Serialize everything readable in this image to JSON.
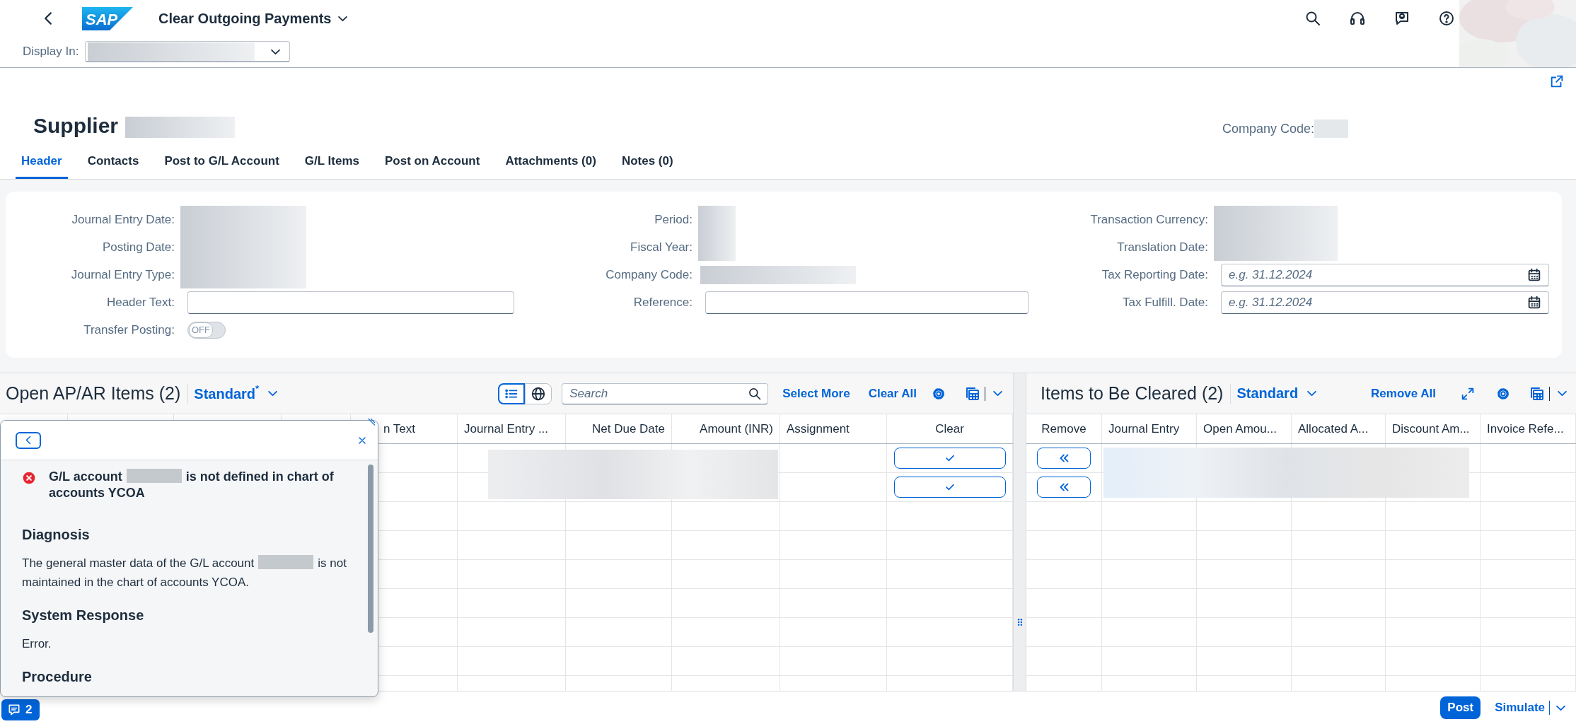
{
  "shell": {
    "logo": "SAP",
    "title": "Clear Outgoing Payments",
    "display_in_label": "Display In:",
    "display_in": {
      "kind": "redacted"
    }
  },
  "header": {
    "title": "Supplier",
    "name": {
      "kind": "redacted"
    },
    "company_code_label": "Company Code:",
    "company_code": {
      "kind": "redacted"
    }
  },
  "tabs": [
    {
      "label": "Header",
      "selected": true
    },
    {
      "label": "Contacts",
      "selected": false
    },
    {
      "label": "Post to G/L Account",
      "selected": false
    },
    {
      "label": "G/L Items",
      "selected": false
    },
    {
      "label": "Post on Account",
      "selected": false
    },
    {
      "label": "Attachments (0)",
      "selected": false
    },
    {
      "label": "Notes (0)",
      "selected": false
    }
  ],
  "form": {
    "columns": [
      {
        "fields": [
          {
            "label": "Journal Entry Date:",
            "kind": "redacted"
          },
          {
            "label": "Posting Date:",
            "kind": "redacted"
          },
          {
            "label": "Journal Entry Type:",
            "kind": "redacted"
          },
          {
            "label": "Header Text:",
            "kind": "input"
          },
          {
            "label": "Transfer Posting:",
            "kind": "switch",
            "on": false,
            "text": "OFF"
          }
        ]
      },
      {
        "fields": [
          {
            "label": "Period:",
            "kind": "redacted"
          },
          {
            "label": "Fiscal Year:",
            "kind": "redacted"
          },
          {
            "label": "Company Code:",
            "kind": "redacted"
          },
          {
            "label": "Reference:",
            "kind": "input"
          }
        ]
      },
      {
        "fields": [
          {
            "label": "Transaction Currency:",
            "kind": "redacted"
          },
          {
            "label": "Translation Date:",
            "kind": "redacted"
          },
          {
            "label": "Tax Reporting Date:",
            "kind": "date",
            "placeholder": "e.g. 31.12.2024"
          },
          {
            "label": "Tax Fulfill. Date:",
            "kind": "date",
            "placeholder": "e.g. 31.12.2024"
          }
        ]
      }
    ]
  },
  "open_items": {
    "title": "Open AP/AR Items (2)",
    "variant": "Standard$^{*}$",
    "view_modes": [
      {
        "kind": "list",
        "selected": true
      },
      {
        "kind": "globe",
        "selected": false
      }
    ],
    "search_placeholder": "Search",
    "actions": [
      "Select More",
      "Clear All"
    ],
    "redacted": true,
    "columns": [
      "n Text",
      "Journal Entry ...",
      "Net Due Date",
      "Amount (INR)",
      "Assignment",
      "Clear"
    ],
    "rows": [
      {
        "kind": "item"
      },
      {
        "kind": "item"
      },
      {
        "kind": "empty"
      },
      {
        "kind": "empty"
      },
      {
        "kind": "empty"
      },
      {
        "kind": "empty"
      },
      {
        "kind": "empty"
      },
      {
        "kind": "empty"
      },
      {
        "kind": "empty"
      }
    ]
  },
  "cleared_items": {
    "title": "Items to Be Cleared (2)",
    "variant": "Standard",
    "actions": [
      "Remove All"
    ],
    "redacted": true,
    "columns": [
      "Remove",
      "Journal Entry",
      "Open Amou...",
      "Allocated A...",
      "Discount Am...",
      "Invoice Refe..."
    ],
    "rows": [
      {
        "kind": "item"
      },
      {
        "kind": "item"
      },
      {
        "kind": "empty"
      },
      {
        "kind": "empty"
      },
      {
        "kind": "empty"
      },
      {
        "kind": "empty"
      },
      {
        "kind": "empty"
      },
      {
        "kind": "empty"
      },
      {
        "kind": "empty"
      }
    ]
  },
  "message_popover": {
    "title": [
      {
        "kind": "text",
        "text": "G/L account"
      },
      {
        "kind": "redacted"
      },
      {
        "kind": "text",
        "text": "is not defined in chart of accounts YCOA"
      }
    ],
    "sections": [
      {
        "heading": "Diagnosis",
        "body": [
          {
            "kind": "text",
            "text": "The general master data of the G/L account"
          },
          {
            "kind": "redacted"
          },
          {
            "kind": "text",
            "text": "is not maintained in the chart of accounts YCOA."
          }
        ]
      },
      {
        "heading": "System Response",
        "body": [
          {
            "kind": "text",
            "text": "Error."
          }
        ]
      },
      {
        "heading": "Procedure"
      }
    ]
  },
  "footer": {
    "message_count": "2",
    "primary": "Post",
    "secondary": "Simulate"
  }
}
